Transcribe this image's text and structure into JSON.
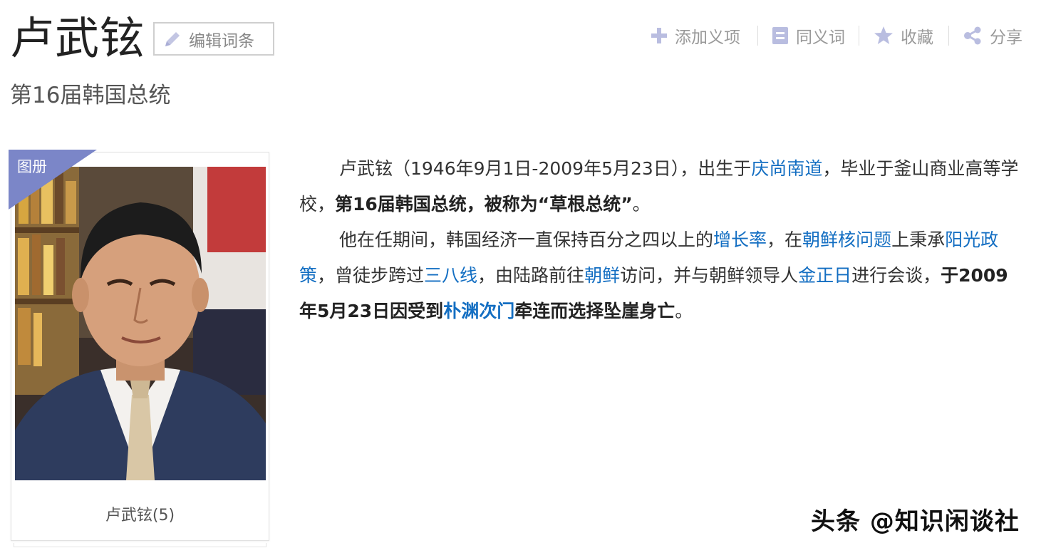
{
  "header": {
    "title": "卢武铉",
    "edit_label": "编辑词条",
    "subtitle": "第16届韩国总统"
  },
  "toolbar": {
    "add_item": "添加义项",
    "synonym": "同义词",
    "favorite": "收藏",
    "share": "分享"
  },
  "album": {
    "badge": "图册",
    "caption": "卢武铉(5)"
  },
  "summary": {
    "p1": {
      "t1": "卢武铉（1946年9月1日-2009年5月23日），出生于",
      "link_qingshang": "庆尚南道",
      "t2": "，毕业于釜山商业高等学校，",
      "b1": "第16届韩国总统，被称为“草根总统”",
      "t3": "。"
    },
    "p2": {
      "t1": "他在任期间，韩国经济一直保持百分之四以上的",
      "link_growth": "增长率",
      "t2": "，在",
      "link_nuclear": "朝鲜核问题",
      "t3": "上秉承",
      "link_sunshine": "阳光政策",
      "t4": "，曾徒步跨过",
      "link_38": "三八线",
      "t5": "，由陆路前往",
      "link_nk": "朝鲜",
      "t6": "访问，并与朝鲜领导人",
      "link_kim": "金正日",
      "t7": "进行会谈，",
      "b1": "于2009年5月23日因受到",
      "link_park": "朴渊次门",
      "b2": "牵连而选择坠崖身亡",
      "t8": "。"
    }
  },
  "watermark": "头条 @知识闲谈社",
  "colors": {
    "link": "#136ec2",
    "badge": "#7b86c8",
    "icon": "#b9bde0"
  }
}
